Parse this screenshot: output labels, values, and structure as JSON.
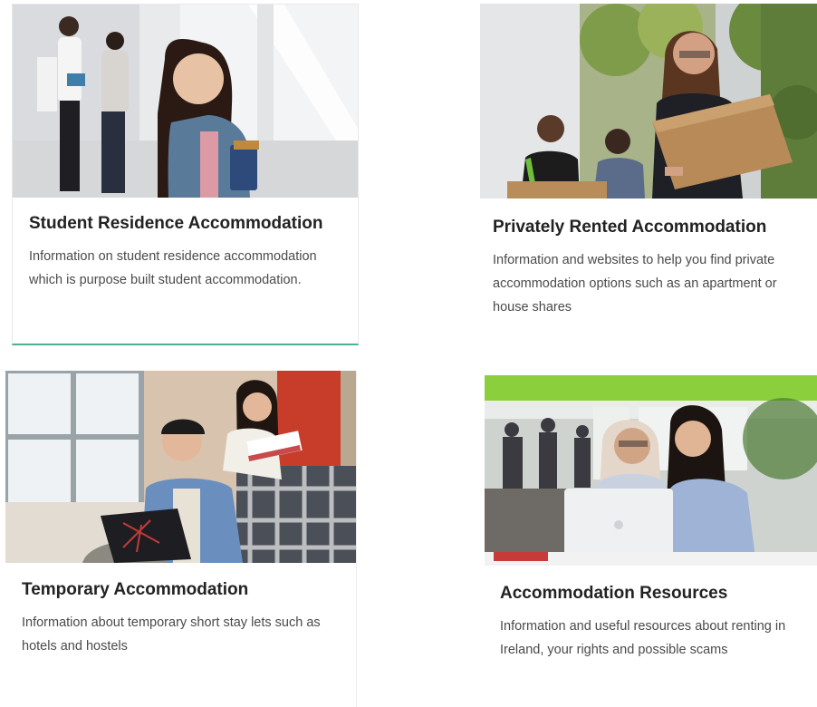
{
  "cards": [
    {
      "title": "Student Residence Accommodation",
      "description": "Information on student residence accommodation which is purpose built student accommodation."
    },
    {
      "title": "Privately Rented Accommodation",
      "description": "Information and websites to help you find private accommodation options such as an apartment or house shares"
    },
    {
      "title": "Temporary Accommodation",
      "description": "Information about temporary short stay lets such as hotels and hostels"
    },
    {
      "title": "Accommodation Resources",
      "description": "Information and useful resources about renting in Ireland, your rights and possible scams"
    }
  ],
  "colors": {
    "accent_underline": "#4fae95",
    "title_text": "#222222",
    "body_text": "#4a4a4a"
  }
}
